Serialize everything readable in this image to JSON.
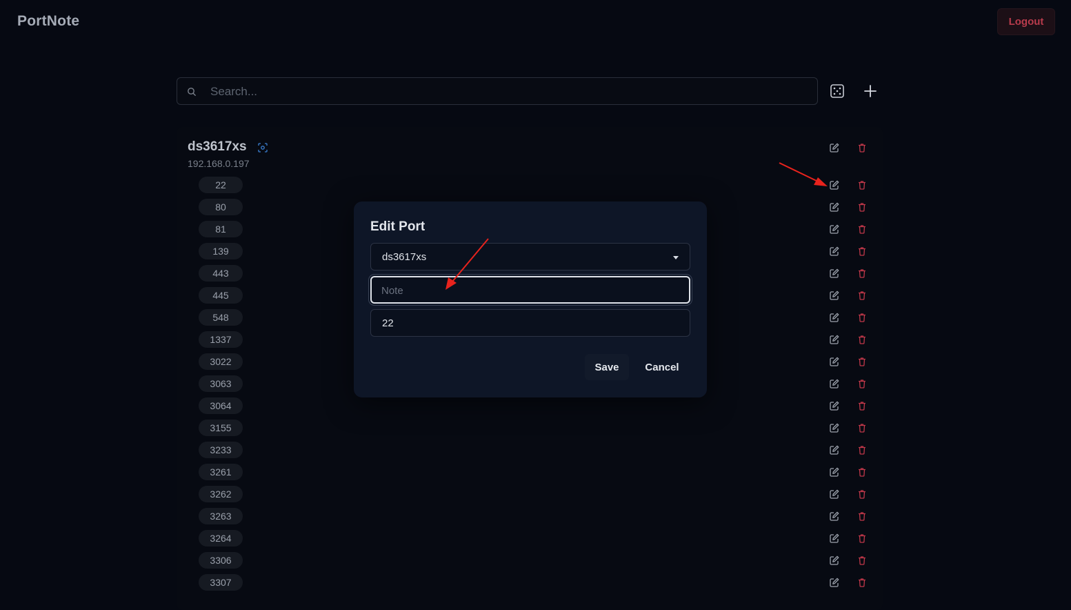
{
  "app": {
    "title": "PortNote",
    "logout_label": "Logout"
  },
  "search": {
    "placeholder": "Search..."
  },
  "server": {
    "name": "ds3617xs",
    "ip": "192.168.0.197"
  },
  "ports": [
    "22",
    "80",
    "81",
    "139",
    "443",
    "445",
    "548",
    "1337",
    "3022",
    "3063",
    "3064",
    "3155",
    "3233",
    "3261",
    "3262",
    "3263",
    "3264",
    "3306",
    "3307"
  ],
  "modal": {
    "title": "Edit Port",
    "server_value": "ds3617xs",
    "note_placeholder": "Note",
    "port_value": "22",
    "save_label": "Save",
    "cancel_label": "Cancel"
  },
  "colors": {
    "background": "#060912",
    "danger": "#b83b4c",
    "modal": "#0e1627",
    "annotation_arrow": "#e8231d"
  }
}
